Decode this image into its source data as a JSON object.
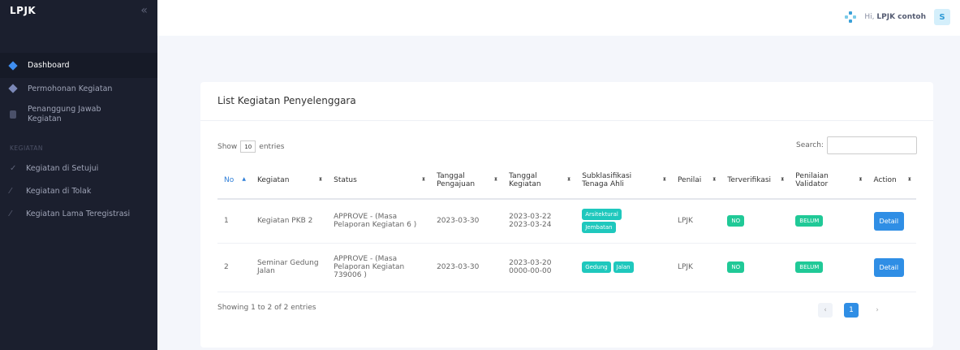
{
  "sidebar": {
    "brand": "LPJK",
    "collapse_icon": "«",
    "items": [
      {
        "label": "Dashboard"
      },
      {
        "label": "Permohonan Kegiatan"
      },
      {
        "label": "Penanggung Jawab Kegiatan"
      }
    ],
    "section_label": "KEGIATAN",
    "sub_items": [
      {
        "label": "Kegiatan di Setujui",
        "icon": "check-icon"
      },
      {
        "label": "Kegiatan di Tolak",
        "icon": "cross-icon"
      },
      {
        "label": "Kegiatan Lama Teregistrasi",
        "icon": "cross-icon"
      }
    ]
  },
  "topbar": {
    "greeting": "Hi,",
    "username": "LPJK contoh",
    "avatar_letter": "S"
  },
  "card": {
    "title": "List Kegiatan Penyelenggara",
    "show_label": "Show",
    "entries_value": "10",
    "entries_label": "entries",
    "search_label": "Search:",
    "search_value": "",
    "columns": [
      "No",
      "Kegiatan",
      "Status",
      "Tanggal Pengajuan",
      "Tanggal Kegiatan",
      "Subklasifikasi Tenaga Ahli",
      "Penilai",
      "Terverifikasi",
      "Penilaian Validator",
      "Action"
    ],
    "rows": [
      {
        "no": "1",
        "kegiatan": "Kegiatan PKB 2",
        "status": "APPROVE - (Masa Pelaporan Kegiatan 6 )",
        "tgl_pengajuan": "2023-03-30",
        "tgl_kegiatan_start": "2023-03-22",
        "tgl_kegiatan_end": "2023-03-24",
        "sub_badges": [
          "Arsitektural",
          "Jembatan"
        ],
        "penilai": "LPJK",
        "terverifikasi": "NO",
        "validator": "BELUM",
        "action": "Detail"
      },
      {
        "no": "2",
        "kegiatan": "Seminar Gedung Jalan",
        "status": "APPROVE - (Masa Pelaporan Kegiatan 739006 )",
        "tgl_pengajuan": "2023-03-30",
        "tgl_kegiatan_start": "2023-03-20",
        "tgl_kegiatan_end": "0000-00-00",
        "sub_badges": [
          "Gedung",
          "Jalan"
        ],
        "penilai": "LPJK",
        "terverifikasi": "NO",
        "validator": "BELUM",
        "action": "Detail"
      }
    ],
    "info": "Showing 1 to 2 of 2 entries",
    "pager": {
      "prev": "‹",
      "current": "1",
      "next": "›"
    }
  },
  "colors": {
    "accent": "#2f8ee5",
    "badge": "#1fc8bd",
    "sidebar": "#1b1f2e"
  }
}
